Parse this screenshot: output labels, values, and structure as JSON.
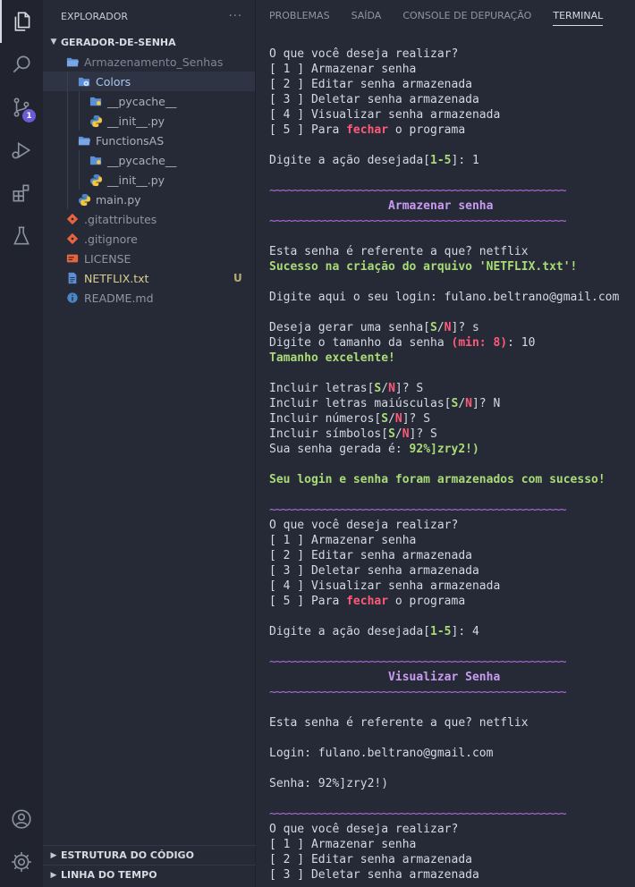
{
  "activity_bar": {
    "source_control_badge": "1",
    "colors": {
      "icon": "#c9ccd4",
      "active_border": "#d7dae0",
      "badge": "#6b5bd6"
    }
  },
  "sidebar": {
    "title": "EXPLORADOR",
    "more_actions": "···",
    "root_folder": "GERADOR-DE-SENHA",
    "tree": [
      {
        "name": "Armazenamento_Senhas",
        "indent": 1,
        "type": "folder-open",
        "dim": true
      },
      {
        "name": "Colors",
        "indent": 2,
        "type": "folder-special",
        "selected": true
      },
      {
        "name": "__pycache__",
        "indent": 3,
        "type": "folder"
      },
      {
        "name": "__init__.py",
        "indent": 3,
        "type": "python"
      },
      {
        "name": "FunctionsAS",
        "indent": 2,
        "type": "folder-open"
      },
      {
        "name": "__pycache__",
        "indent": 3,
        "type": "folder"
      },
      {
        "name": "__init__.py",
        "indent": 3,
        "type": "python"
      },
      {
        "name": "main.py",
        "indent": 2,
        "type": "python"
      },
      {
        "name": ".gitattributes",
        "indent": 1,
        "type": "git"
      },
      {
        "name": ".gitignore",
        "indent": 1,
        "type": "git"
      },
      {
        "name": "LICENSE",
        "indent": 1,
        "type": "license"
      },
      {
        "name": "NETFLIX.txt",
        "indent": 1,
        "type": "text",
        "status": "U",
        "highlight": true
      },
      {
        "name": "README.md",
        "indent": 1,
        "type": "info"
      }
    ],
    "bottom_sections": [
      "ESTRUTURA DO CÓDIGO",
      "LINHA DO TEMPO"
    ]
  },
  "panel": {
    "tabs": [
      "PROBLEMAS",
      "SAÍDA",
      "CONSOLE DE DEPURAÇÃO",
      "TERMINAL"
    ],
    "active_tab": "TERMINAL"
  },
  "terminal": {
    "colors": {
      "green": "#a9dc76",
      "red": "#ff5a78",
      "title": "#c99bf0",
      "separator": "#b36de0"
    },
    "lines": [
      [
        {
          "t": "O que você deseja realizar?"
        }
      ],
      [
        {
          "t": "[ 1 ] Armazenar senha"
        }
      ],
      [
        {
          "t": "[ 2 ] Editar senha armazenada"
        }
      ],
      [
        {
          "t": "[ 3 ] Deletar senha armazenada"
        }
      ],
      [
        {
          "t": "[ 4 ] Visualizar senha armazenada"
        }
      ],
      [
        {
          "t": "[ 5 ] Para "
        },
        {
          "t": "fechar",
          "c": "red"
        },
        {
          "t": " o programa"
        }
      ],
      [],
      [
        {
          "t": "Digite a ação desejada["
        },
        {
          "t": "1-5",
          "c": "green"
        },
        {
          "t": "]: 1"
        }
      ],
      [],
      [
        {
          "t": "~~~~~~~~~~~~~~~~~~~~~~~~~~~~~~~~~~~~~~~~~~~~~~~~~~",
          "c": "sep"
        }
      ],
      [
        {
          "t": "                 Armazenar senha",
          "c": "title"
        }
      ],
      [
        {
          "t": "~~~~~~~~~~~~~~~~~~~~~~~~~~~~~~~~~~~~~~~~~~~~~~~~~~",
          "c": "sep"
        }
      ],
      [],
      [
        {
          "t": "Esta senha é referente a que? netflix"
        }
      ],
      [
        {
          "t": "Sucesso na criação do arquivo 'NETFLIX.txt'!",
          "c": "green"
        }
      ],
      [],
      [
        {
          "t": "Digite aqui o seu login: fulano.beltrano@gmail.com"
        }
      ],
      [],
      [
        {
          "t": "Deseja gerar uma senha["
        },
        {
          "t": "S",
          "c": "green"
        },
        {
          "t": "/"
        },
        {
          "t": "N",
          "c": "red"
        },
        {
          "t": "]? s"
        }
      ],
      [
        {
          "t": "Digite o tamanho da senha "
        },
        {
          "t": "(min: 8)",
          "c": "red"
        },
        {
          "t": ": 10"
        }
      ],
      [
        {
          "t": "Tamanho excelente!",
          "c": "green"
        }
      ],
      [],
      [
        {
          "t": "Incluir letras["
        },
        {
          "t": "S",
          "c": "green"
        },
        {
          "t": "/"
        },
        {
          "t": "N",
          "c": "red"
        },
        {
          "t": "]? S"
        }
      ],
      [
        {
          "t": "Incluir letras maiúsculas["
        },
        {
          "t": "S",
          "c": "green"
        },
        {
          "t": "/"
        },
        {
          "t": "N",
          "c": "red"
        },
        {
          "t": "]? N"
        }
      ],
      [
        {
          "t": "Incluir números["
        },
        {
          "t": "S",
          "c": "green"
        },
        {
          "t": "/"
        },
        {
          "t": "N",
          "c": "red"
        },
        {
          "t": "]? S"
        }
      ],
      [
        {
          "t": "Incluir símbolos["
        },
        {
          "t": "S",
          "c": "green"
        },
        {
          "t": "/"
        },
        {
          "t": "N",
          "c": "red"
        },
        {
          "t": "]? S"
        }
      ],
      [
        {
          "t": "Sua senha gerada é: "
        },
        {
          "t": "92%]zry2!)",
          "c": "green"
        }
      ],
      [],
      [
        {
          "t": "Seu login e senha foram armazenados com sucesso!",
          "c": "green"
        }
      ],
      [],
      [
        {
          "t": "~~~~~~~~~~~~~~~~~~~~~~~~~~~~~~~~~~~~~~~~~~~~~~~~~~",
          "c": "sep"
        }
      ],
      [
        {
          "t": "O que você deseja realizar?"
        }
      ],
      [
        {
          "t": "[ 1 ] Armazenar senha"
        }
      ],
      [
        {
          "t": "[ 2 ] Editar senha armazenada"
        }
      ],
      [
        {
          "t": "[ 3 ] Deletar senha armazenada"
        }
      ],
      [
        {
          "t": "[ 4 ] Visualizar senha armazenada"
        }
      ],
      [
        {
          "t": "[ 5 ] Para "
        },
        {
          "t": "fechar",
          "c": "red"
        },
        {
          "t": " o programa"
        }
      ],
      [],
      [
        {
          "t": "Digite a ação desejada["
        },
        {
          "t": "1-5",
          "c": "green"
        },
        {
          "t": "]: 4"
        }
      ],
      [],
      [
        {
          "t": "~~~~~~~~~~~~~~~~~~~~~~~~~~~~~~~~~~~~~~~~~~~~~~~~~~",
          "c": "sep"
        }
      ],
      [
        {
          "t": "                 Visualizar Senha",
          "c": "title"
        }
      ],
      [
        {
          "t": "~~~~~~~~~~~~~~~~~~~~~~~~~~~~~~~~~~~~~~~~~~~~~~~~~~",
          "c": "sep"
        }
      ],
      [],
      [
        {
          "t": "Esta senha é referente a que? netflix"
        }
      ],
      [],
      [
        {
          "t": "Login: fulano.beltrano@gmail.com"
        }
      ],
      [],
      [
        {
          "t": "Senha: 92%]zry2!)"
        }
      ],
      [],
      [
        {
          "t": "~~~~~~~~~~~~~~~~~~~~~~~~~~~~~~~~~~~~~~~~~~~~~~~~~~",
          "c": "sep"
        }
      ],
      [
        {
          "t": "O que você deseja realizar?"
        }
      ],
      [
        {
          "t": "[ 1 ] Armazenar senha"
        }
      ],
      [
        {
          "t": "[ 2 ] Editar senha armazenada"
        }
      ],
      [
        {
          "t": "[ 3 ] Deletar senha armazenada"
        }
      ]
    ]
  }
}
